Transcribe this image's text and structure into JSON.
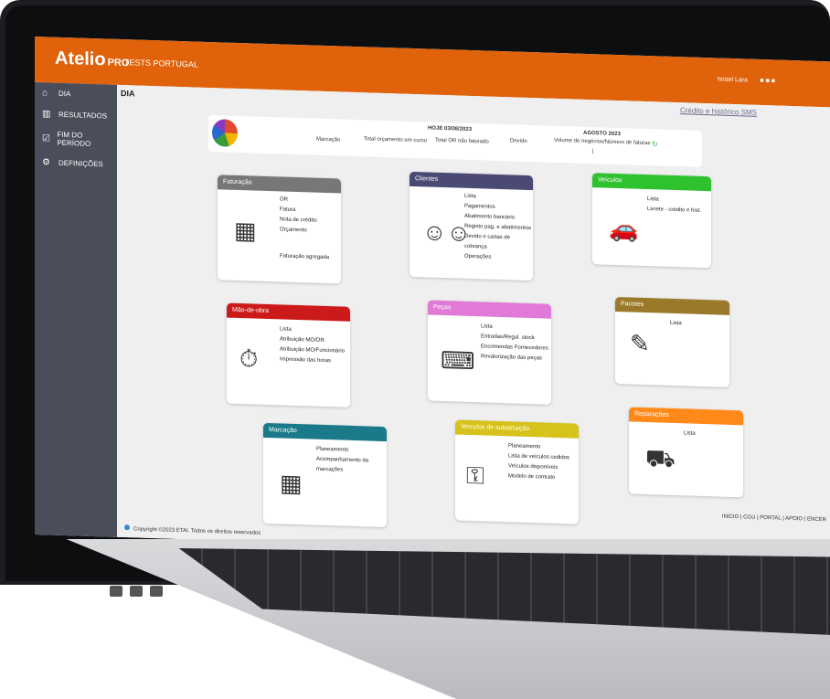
{
  "app": {
    "logo": "Atelio",
    "logo_pro": "PRO",
    "company": "TESTS PORTUGAL",
    "user": "Israel Lara"
  },
  "sidebar": {
    "items": [
      {
        "label": "DIA",
        "icon": "home-icon"
      },
      {
        "label": "RESULTADOS",
        "icon": "chart-icon"
      },
      {
        "label": "FIM DO PERÍODO",
        "icon": "calendar-check-icon"
      },
      {
        "label": "DEFINIÇÕES",
        "icon": "gear-icon"
      }
    ]
  },
  "page": {
    "title": "DIA",
    "sms_link": "Crédito e histórico SMS"
  },
  "summary": {
    "today_label": "HOJE 03/08/2023",
    "month_label": "AGOSTO 2023",
    "columns": [
      "Marcação",
      "Total orçamento em curso",
      "Total OR não faturado",
      "Devido",
      "Volume de negócios/Número de faturas"
    ],
    "divider": "|"
  },
  "cards": {
    "faturacao": {
      "title": "Faturação",
      "color": "#777777",
      "items": [
        "OR",
        "Fatura",
        "Nota de crédito",
        "Orçamento"
      ],
      "extra": "Faturação agregada"
    },
    "clientes": {
      "title": "Clientes",
      "color": "#4a4a75",
      "items": [
        "Lista",
        "Pagamentos",
        "Abatimento bancário",
        "Registo pag. e abatimentos",
        "Devido e cartas de cobrança",
        "Operações"
      ]
    },
    "veiculos": {
      "title": "Veículos",
      "color": "#2ec22e",
      "items": [
        "Lista",
        "Livrete - crédito e hist."
      ]
    },
    "maodeobra": {
      "title": "Mão-de-obra",
      "color": "#cc1a1a",
      "items": [
        "Lista",
        "Atribuição MO/OR.",
        "Atribuição MO/Funcionário",
        "Impressão das horas"
      ]
    },
    "pecas": {
      "title": "Peças",
      "color": "#e07ad6",
      "items": [
        "Lista",
        "Entradas/Regul. stock",
        "Encomendas Fornecedores",
        "Revalorização das peças"
      ]
    },
    "pacotes": {
      "title": "Pacotes",
      "color": "#9a7a2a",
      "items": [
        "Lista"
      ]
    },
    "marcacao": {
      "title": "Marcação",
      "color": "#1a7a8a",
      "items": [
        "Planeamento",
        "Acompanhamento da marcações"
      ]
    },
    "substituicao": {
      "title": "Veículos de substituição",
      "color": "#d6c21a",
      "items": [
        "Planeamento",
        "Lista de veículos cedidos",
        "Veículos disponíveis",
        "Modelo de contrato"
      ]
    },
    "reparacoes": {
      "title": "Reparações",
      "color": "#ff8a1a",
      "items": [
        "Lista"
      ]
    }
  },
  "footer": {
    "copyright": "Copyright ©2023 ETAI. Todos os direitos reservados",
    "links": "INÍCIO | CGU | PORTAL | APOIO | ENCER"
  }
}
